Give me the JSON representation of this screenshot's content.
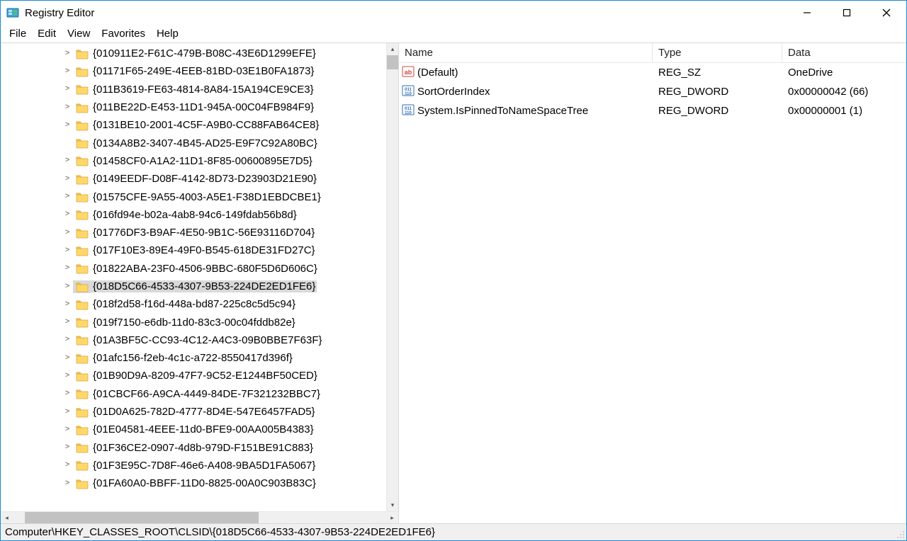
{
  "window": {
    "title": "Registry Editor"
  },
  "menu": {
    "items": [
      "File",
      "Edit",
      "View",
      "Favorites",
      "Help"
    ]
  },
  "tree": {
    "selected_index": 13,
    "nodes": [
      {
        "label": "{010911E2-F61C-479B-B08C-43E6D1299EFE}",
        "expandable": true
      },
      {
        "label": "{01171F65-249E-4EEB-81BD-03E1B0FA1873}",
        "expandable": true
      },
      {
        "label": "{011B3619-FE63-4814-8A84-15A194CE9CE3}",
        "expandable": true
      },
      {
        "label": "{011BE22D-E453-11D1-945A-00C04FB984F9}",
        "expandable": true
      },
      {
        "label": "{0131BE10-2001-4C5F-A9B0-CC88FAB64CE8}",
        "expandable": true
      },
      {
        "label": "{0134A8B2-3407-4B45-AD25-E9F7C92A80BC}",
        "expandable": false
      },
      {
        "label": "{01458CF0-A1A2-11D1-8F85-00600895E7D5}",
        "expandable": true
      },
      {
        "label": "{0149EEDF-D08F-4142-8D73-D23903D21E90}",
        "expandable": true
      },
      {
        "label": "{01575CFE-9A55-4003-A5E1-F38D1EBDCBE1}",
        "expandable": true
      },
      {
        "label": "{016fd94e-b02a-4ab8-94c6-149fdab56b8d}",
        "expandable": true
      },
      {
        "label": "{01776DF3-B9AF-4E50-9B1C-56E93116D704}",
        "expandable": true
      },
      {
        "label": "{017F10E3-89E4-49F0-B545-618DE31FD27C}",
        "expandable": true
      },
      {
        "label": "{01822ABA-23F0-4506-9BBC-680F5D6D606C}",
        "expandable": true
      },
      {
        "label": "{018D5C66-4533-4307-9B53-224DE2ED1FE6}",
        "expandable": true
      },
      {
        "label": "{018f2d58-f16d-448a-bd87-225c8c5d5c94}",
        "expandable": true
      },
      {
        "label": "{019f7150-e6db-11d0-83c3-00c04fddb82e}",
        "expandable": true
      },
      {
        "label": "{01A3BF5C-CC93-4C12-A4C3-09B0BBE7F63F}",
        "expandable": true
      },
      {
        "label": "{01afc156-f2eb-4c1c-a722-8550417d396f}",
        "expandable": true
      },
      {
        "label": "{01B90D9A-8209-47F7-9C52-E1244BF50CED}",
        "expandable": true
      },
      {
        "label": "{01CBCF66-A9CA-4449-84DE-7F321232BBC7}",
        "expandable": true
      },
      {
        "label": "{01D0A625-782D-4777-8D4E-547E6457FAD5}",
        "expandable": true
      },
      {
        "label": "{01E04581-4EEE-11d0-BFE9-00AA005B4383}",
        "expandable": true
      },
      {
        "label": "{01F36CE2-0907-4d8b-979D-F151BE91C883}",
        "expandable": true
      },
      {
        "label": "{01F3E95C-7D8F-46e6-A408-9BA5D1FA5067}",
        "expandable": true
      },
      {
        "label": "{01FA60A0-BBFF-11D0-8825-00A0C903B83C}",
        "expandable": true
      }
    ]
  },
  "list": {
    "columns": {
      "name": "Name",
      "type": "Type",
      "data": "Data"
    },
    "rows": [
      {
        "icon": "string",
        "name": "(Default)",
        "type": "REG_SZ",
        "data": "OneDrive"
      },
      {
        "icon": "binary",
        "name": "SortOrderIndex",
        "type": "REG_DWORD",
        "data": "0x00000042 (66)"
      },
      {
        "icon": "binary",
        "name": "System.IsPinnedToNameSpaceTree",
        "type": "REG_DWORD",
        "data": "0x00000001 (1)"
      }
    ]
  },
  "statusbar": {
    "path": "Computer\\HKEY_CLASSES_ROOT\\CLSID\\{018D5C66-4533-4307-9B53-224DE2ED1FE6}"
  }
}
